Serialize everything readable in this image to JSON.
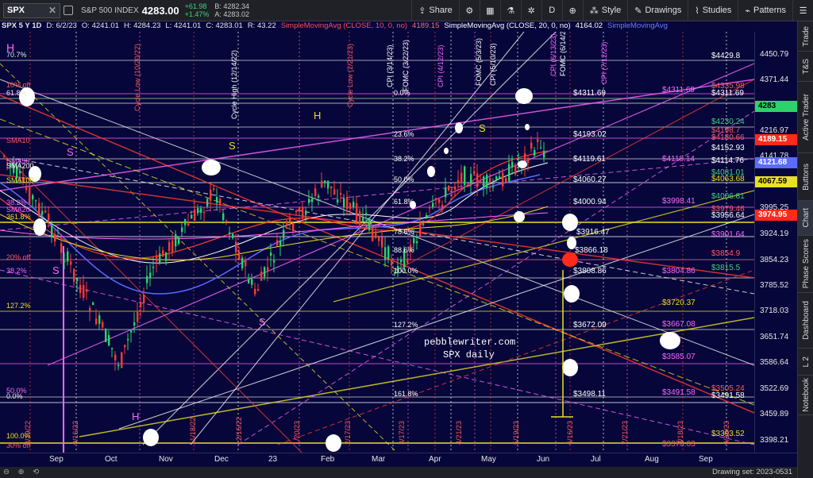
{
  "toolbar": {
    "symbol": "SPX",
    "clear_icon": "✕",
    "index_name": "S&P 500 INDEX",
    "last_price": "4283.00",
    "net_change": "+61.98",
    "pct_change": "+1.47%",
    "bid": "B: 4282.34",
    "ask": "A: 4283.02",
    "share_label": "Share",
    "period_label": "D",
    "style_label": "Style",
    "drawings_label": "Drawings",
    "studies_label": "Studies",
    "patterns_label": "Patterns"
  },
  "status_line": {
    "header": "SPX 5 Y 1D",
    "date": "D: 6/2/23",
    "open": "O: 4241.01",
    "high": "H: 4284.23",
    "low": "L: 4241.01",
    "close": "C: 4283.01",
    "range": "R: 43.22",
    "sma10_name": "SimpleMovingAvg (CLOSE, 10, 0, no)",
    "sma10_value": "4189.15",
    "sma20_name": "SimpleMovingAvg (CLOSE, 20, 0, no)",
    "sma20_value": "4164.02",
    "sma50_name": "SimpleMovingAvg"
  },
  "colors": {
    "background": "#06063a",
    "sma10": "#ff3b30",
    "sma20": "#ffffff",
    "sma50": "#5a6bff",
    "fib_yellow": "#e8e020",
    "fib_magenta": "#ff66ff",
    "up_candle": "#2bd46b",
    "down_candle": "#ff3b30"
  },
  "price_axis": {
    "ticks": [
      "4450.79",
      "4371.44",
      "4283",
      "4216.97",
      "4141.78",
      "4067.59",
      "3995.25",
      "3924.19",
      "3854.23",
      "3785.52",
      "3718.03",
      "3651.74",
      "3586.64",
      "3522.69",
      "3459.89",
      "3398.21"
    ],
    "tag_last": "4283",
    "tag_sma10": "4189.15",
    "tag_sma50": "4121.68",
    "tag_yellow": "4067.59",
    "tag_red": "3974.95"
  },
  "time_axis": {
    "labels": [
      "Sep",
      "Oct",
      "Nov",
      "Dec",
      "23",
      "Feb",
      "Mar",
      "Apr",
      "May",
      "Jun",
      "Jul",
      "Aug",
      "Sep"
    ]
  },
  "annotations": {
    "watermark_line1": "pebblewriter.com",
    "watermark_line2": "SPX daily",
    "fib_left": [
      "70.7%",
      "10% off",
      "61.8%",
      "38.2%",
      "361.8%",
      "20% off",
      "38.2%",
      "127.2%",
      "100.0%",
      "50.0%",
      "0.0%",
      "30% off"
    ],
    "fib_mid": [
      "0.0%",
      "23.6%",
      "38.2%",
      "50.0%",
      "61.8%",
      "78.6%",
      "88.6%",
      "100.0%",
      "127.2%",
      "161.8%"
    ],
    "levels_white": [
      "$4311.69",
      "$4193.02",
      "$4119.61",
      "$4060.27",
      "$4000.94",
      "$3916.47",
      "$3866.18",
      "$3808.86",
      "$3672.09",
      "$3498.11"
    ],
    "levels_right": [
      "$4429.8",
      "$4335.98",
      "$4311.69",
      "$4311.69",
      "$4230.24",
      "$4198.7",
      "$4180.66",
      "$4152.93",
      "$4118.14",
      "$4114.76",
      "$4081.01",
      "$4063.68",
      "$4006.81",
      "$3998.41",
      "$3979.46",
      "$3956.64",
      "$3901.64",
      "$3854.9",
      "$3815.5",
      "$3804.86",
      "$3720.37",
      "$3667.08",
      "$3585.07",
      "$3505.24",
      "$3491.58",
      "$3491.58",
      "$3393.52",
      "$3373.03"
    ],
    "sma_labels": [
      "SMA10",
      "SMA20",
      "SMA50",
      "SMA100",
      "SMA200"
    ],
    "markers": [
      "H",
      "S",
      "H",
      "S",
      "S",
      "S",
      "S",
      "H"
    ],
    "vertical_events": [
      "Cycle Low (10/20/22)",
      "Cycle High (12/14/22)",
      "Cycle Low (2/21/23)",
      "CPI (3/14/23)",
      "FOMC (3/22/23)",
      "CPI (4/12/23)",
      "FOMC (5/3/23)",
      "CPI (5/10/23)",
      "CPI (6/13/23)",
      "FOMC (6/14/23)",
      "CPI (7/12/23)",
      "8/18/23",
      "7/21/23",
      "9/15/23",
      "11/18/22",
      "12/16/22",
      "1/20/23",
      "2/17/23",
      "3/17/23",
      "4/21/23",
      "5/19/23",
      "6/16/23",
      "9/16/22",
      "8/19/22"
    ]
  },
  "bottom_bar": {
    "drawing_set": "Drawing set: 2023-0531"
  },
  "sidebar": {
    "tabs": [
      "Trade",
      "T&S",
      "Active Trader",
      "Buttons",
      "Chart",
      "Phase Scores",
      "Dashboard",
      "L 2",
      "Notebook"
    ]
  }
}
